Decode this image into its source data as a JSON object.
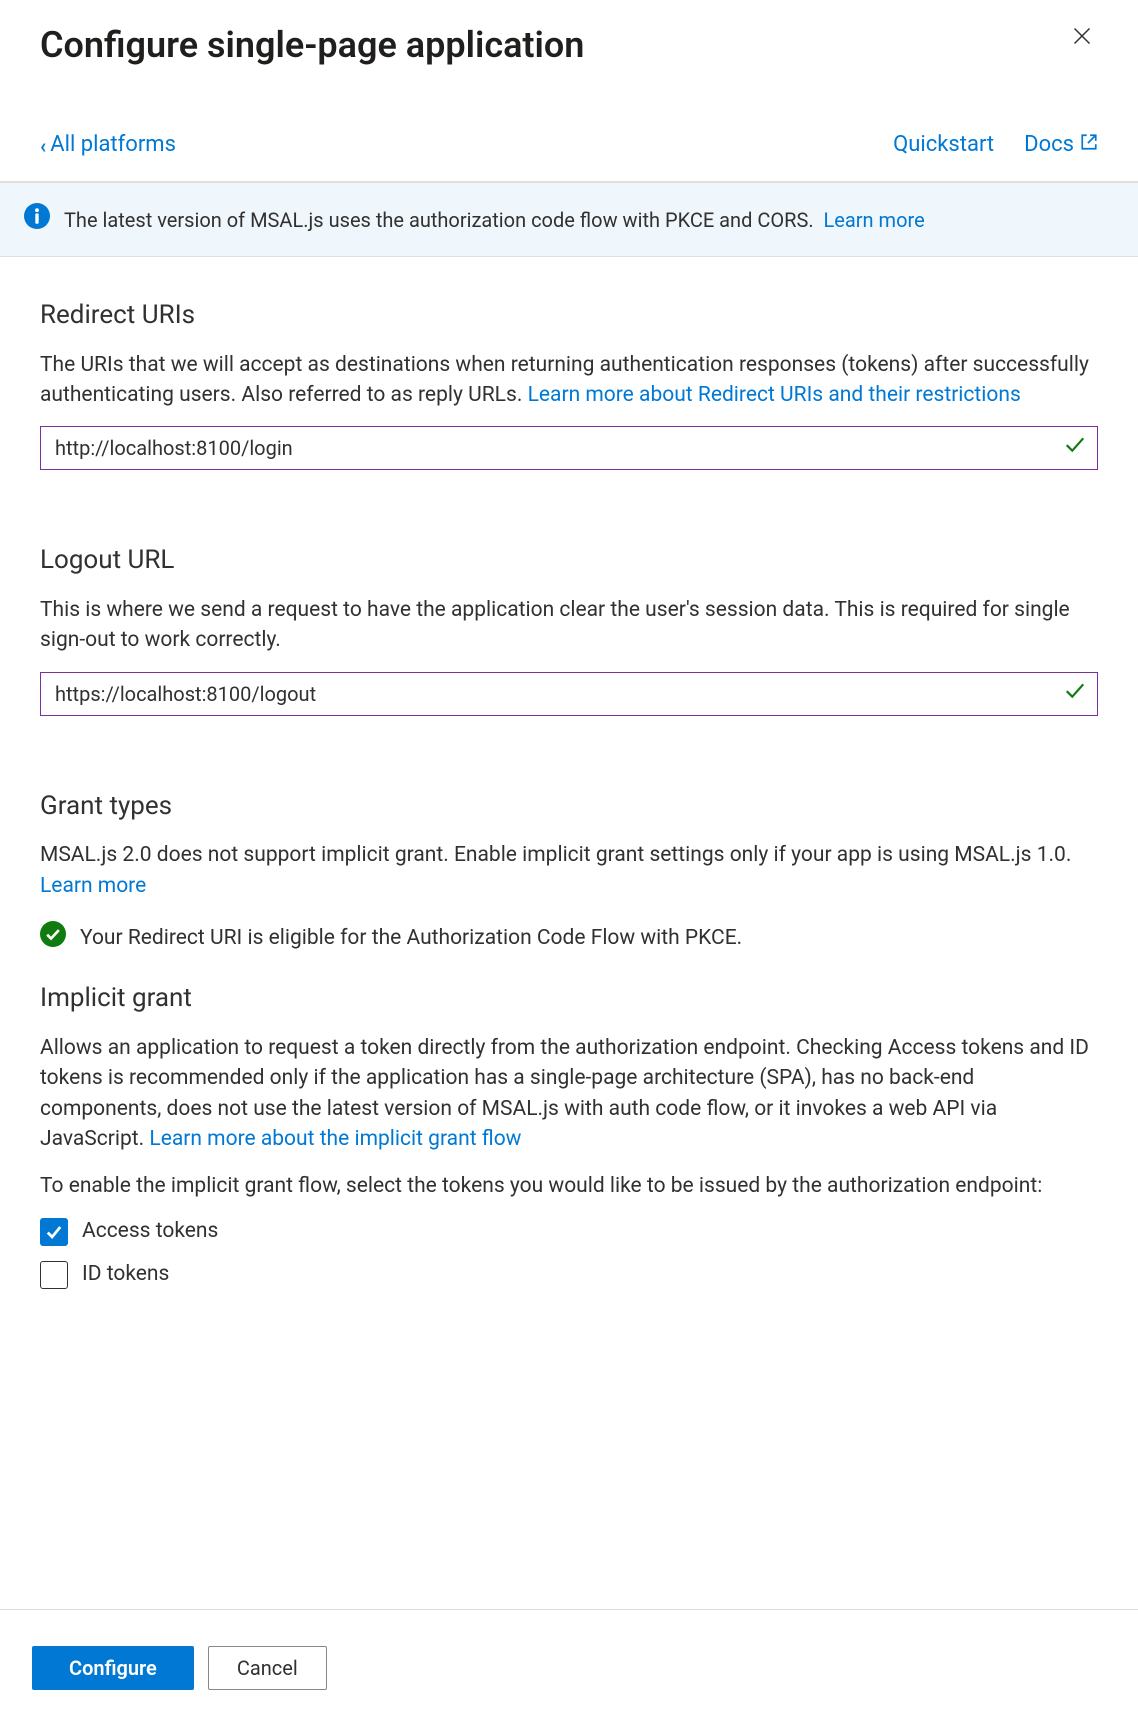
{
  "header": {
    "title": "Configure single-page application"
  },
  "nav": {
    "back": "All platforms",
    "quickstart": "Quickstart",
    "docs": "Docs"
  },
  "banner": {
    "text": "The latest version of MSAL.js uses the authorization code flow with PKCE and CORS.",
    "learn_more": "Learn more"
  },
  "redirect": {
    "heading": "Redirect URIs",
    "desc_part1": "The URIs that we will accept as destinations when returning authentication responses (tokens) after successfully authenticating users. Also referred to as reply URLs. ",
    "learn_more": "Learn more about Redirect URIs and their restrictions",
    "value": "http://localhost:8100/login"
  },
  "logout": {
    "heading": "Logout URL",
    "desc": "This is where we send a request to have the application clear the user's session data. This is required for single sign-out to work correctly.",
    "value": "https://localhost:8100/logout"
  },
  "grant_types": {
    "heading": "Grant types",
    "desc_part1": "MSAL.js 2.0 does not support implicit grant. Enable implicit grant settings only if your app is using MSAL.js 1.0. ",
    "learn_more": "Learn more",
    "success": "Your Redirect URI is eligible for the Authorization Code Flow with PKCE."
  },
  "implicit": {
    "heading": "Implicit grant",
    "desc_part1": "Allows an application to request a token directly from the authorization endpoint. Checking Access tokens and ID tokens is recommended only if the application has a single-page architecture (SPA), has no back-end components, does not use the latest version of MSAL.js with auth code flow, or it invokes a web API via JavaScript. ",
    "learn_more": "Learn more about the implicit grant flow",
    "enable_text": "To enable the implicit grant flow, select the tokens you would like to be issued by the authorization endpoint:",
    "access_tokens": "Access tokens",
    "id_tokens": "ID tokens"
  },
  "footer": {
    "configure": "Configure",
    "cancel": "Cancel"
  }
}
